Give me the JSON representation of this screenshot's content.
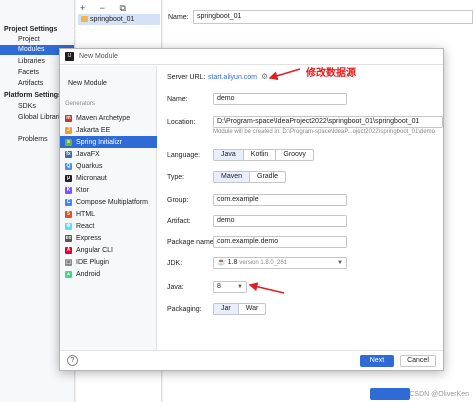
{
  "bg": {
    "project_settings": "Project Settings",
    "project": "Project",
    "modules": "Modules",
    "libraries": "Libraries",
    "facets": "Facets",
    "artifacts": "Artifacts",
    "platform_settings": "Platform Settings",
    "sdks": "SDKs",
    "global_libraries": "Global Libraries",
    "problems": "Problems",
    "toolbar": "+ − ⧉",
    "module_name": "springboot_01",
    "name_label": "Name:",
    "name_value": "springboot_01"
  },
  "dialog": {
    "title": "New Module",
    "new_module": "New Module",
    "generators_label": "Generators",
    "generators": [
      {
        "label": "Maven Archetype",
        "icon": "maven-icon",
        "color": "#c0392b",
        "glyph": "m"
      },
      {
        "label": "Jakarta EE",
        "icon": "jakarta-icon",
        "color": "#f0a030",
        "glyph": "J"
      },
      {
        "label": "Spring Initializr",
        "icon": "spring-icon",
        "color": "#6db33f",
        "glyph": "s"
      },
      {
        "label": "JavaFX",
        "icon": "javafx-icon",
        "color": "#3b6db3",
        "glyph": "fx"
      },
      {
        "label": "Quarkus",
        "icon": "quarkus-icon",
        "color": "#4695eb",
        "glyph": "Q"
      },
      {
        "label": "Micronaut",
        "icon": "micronaut-icon",
        "color": "#222222",
        "glyph": "μ"
      },
      {
        "label": "Ktor",
        "icon": "ktor-icon",
        "color": "#7f52ff",
        "glyph": "K"
      },
      {
        "label": "Compose Multiplatform",
        "icon": "compose-icon",
        "color": "#4285f4",
        "glyph": "C"
      },
      {
        "label": "HTML",
        "icon": "html-icon",
        "color": "#e34f26",
        "glyph": "5"
      },
      {
        "label": "React",
        "icon": "react-icon",
        "color": "#61dafb",
        "glyph": "⚛"
      },
      {
        "label": "Express",
        "icon": "express-icon",
        "color": "#555555",
        "glyph": "ex"
      },
      {
        "label": "Angular CLI",
        "icon": "angular-icon",
        "color": "#dd0031",
        "glyph": "A"
      },
      {
        "label": "IDE Plugin",
        "icon": "plugin-icon",
        "color": "#888888",
        "glyph": "⬚"
      },
      {
        "label": "Android",
        "icon": "android-icon",
        "color": "#3ddc84",
        "glyph": "▲"
      }
    ],
    "server_url_label": "Server URL:",
    "server_url": "start.aliyun.com",
    "name_label": "Name:",
    "name_value": "demo",
    "location_label": "Location:",
    "location_value": "D:\\Program-space\\IdeaProject2022\\springboot_01\\springboot_01",
    "location_hint": "Module will be created in: D:\\Program-space\\IdeaP...oject2022\\springboot_01\\demo",
    "language_label": "Language:",
    "languages": [
      "Java",
      "Kotlin",
      "Groovy"
    ],
    "type_label": "Type:",
    "types": [
      "Maven",
      "Gradle"
    ],
    "group_label": "Group:",
    "group_value": "com.example",
    "artifact_label": "Artifact:",
    "artifact_value": "demo",
    "package_label": "Package name:",
    "package_value": "com.example.demo",
    "jdk_label": "JDK:",
    "jdk_value": "1.8",
    "jdk_version": "version 1.8.0_261",
    "java_label": "Java:",
    "java_value": "8",
    "packaging_label": "Packaging:",
    "packagings": [
      "Jar",
      "War"
    ],
    "help": "?",
    "next": "Next",
    "cancel": "Cancel"
  },
  "annotation": "修改数据源",
  "watermark": "CSDN @OliverKen"
}
